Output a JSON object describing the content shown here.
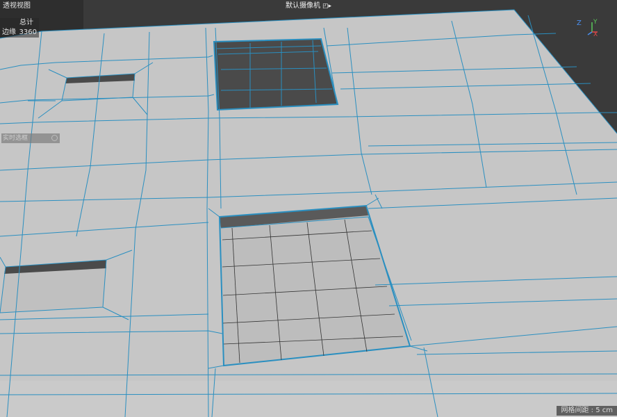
{
  "viewport": {
    "title": "透视视图",
    "camera": "默认摄像机",
    "camera_icon": "camera-icon"
  },
  "stats": {
    "header": "总计",
    "rows": [
      {
        "label": "边缘",
        "value": "3360"
      }
    ]
  },
  "realtime_panel": {
    "label": "实时选框",
    "icon": "target-icon"
  },
  "axis": {
    "z": "Z",
    "x": "X",
    "y": "Y",
    "z_color": "#4a8ff0",
    "x_color": "#e04848",
    "y_color": "#5ac85a"
  },
  "grid_spacing": "网格间距 : 5 cm",
  "colors": {
    "background": "#3a3a3a",
    "surface": "#c6c6c6",
    "wire": "#2a8fc0",
    "hole": "#4a4a4a"
  }
}
